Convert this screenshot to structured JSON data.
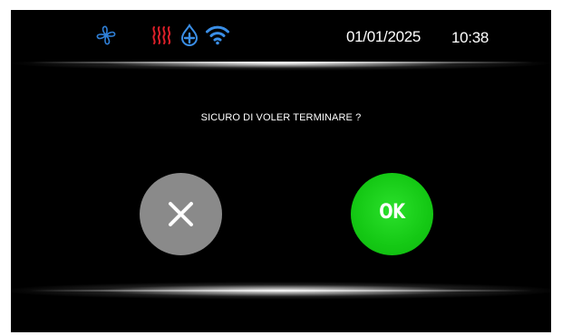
{
  "status_bar": {
    "icons": [
      {
        "name": "fan-icon",
        "color": "#2f7fd6"
      },
      {
        "name": "heat-icon",
        "color": "#e0202a"
      },
      {
        "name": "water-drop-icon",
        "color": "#3a8ee6"
      },
      {
        "name": "wifi-icon",
        "color": "#3a8ee6"
      }
    ],
    "date": "01/01/2025",
    "time": "10:38"
  },
  "dialog": {
    "message": "SICURO DI VOLER TERMINARE ?",
    "cancel_icon": "close-icon",
    "ok_label": "OK"
  },
  "colors": {
    "background": "#000000",
    "cancel_button": "#8a8a8a",
    "ok_button": "#14c814",
    "text": "#ffffff"
  }
}
